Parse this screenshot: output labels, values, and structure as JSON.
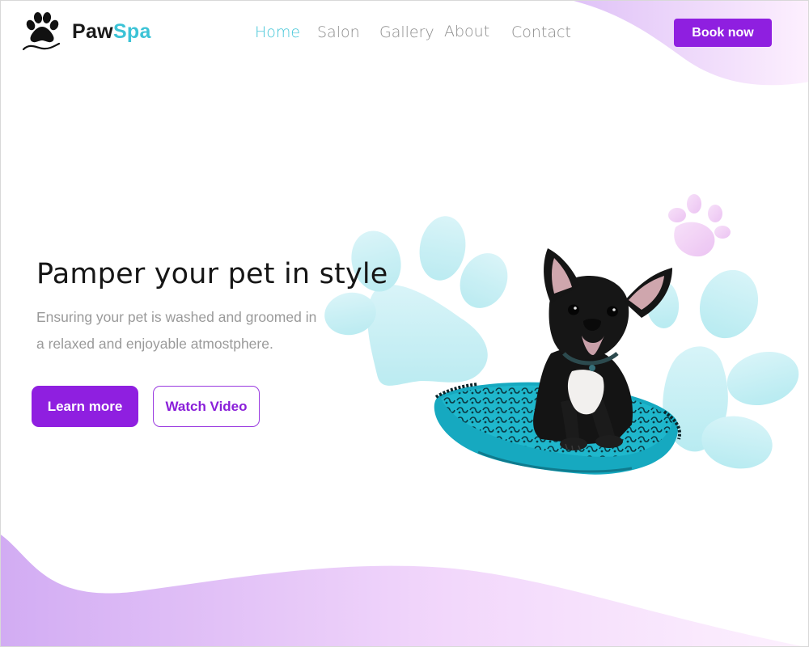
{
  "brand": {
    "name_part1": "Paw",
    "name_part2": "Spa",
    "logo_icon": "paw-print-icon"
  },
  "nav": {
    "items": [
      {
        "label": "Home",
        "active": true
      },
      {
        "label": "Salon",
        "active": false
      },
      {
        "label": "Gallery",
        "active": false
      },
      {
        "label": "About",
        "active": false
      },
      {
        "label": "Contact",
        "active": false
      }
    ],
    "cta_label": "Book now"
  },
  "hero": {
    "title": "Pamper your pet in style",
    "subtitle_line1": "Ensuring your pet is washed and groomed in",
    "subtitle_line2": "a relaxed and enjoyable atmostphere.",
    "primary_button": "Learn more",
    "secondary_button": "Watch Video",
    "image": "french-bulldog-puppy-on-cushion"
  },
  "colors": {
    "accent_purple": "#8f1fe0",
    "accent_teal": "#45c6d8",
    "paw_teal": "#bdeef3",
    "paw_pink": "#efc4f4",
    "wave_left": "#d7b5f5",
    "wave_right": "#fbeafd"
  }
}
